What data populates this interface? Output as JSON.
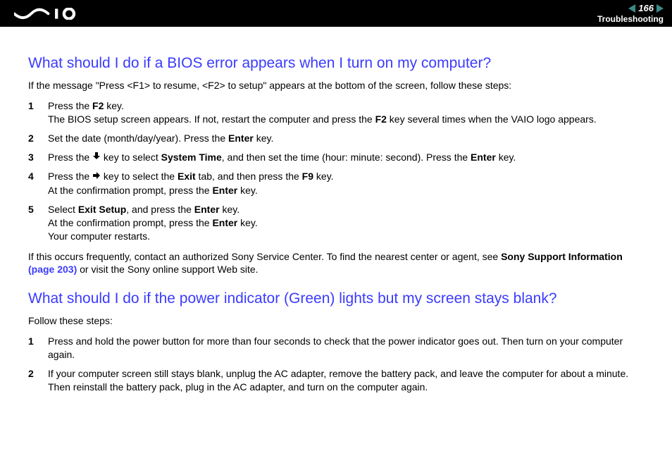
{
  "header": {
    "page_number": "166",
    "section": "Troubleshooting"
  },
  "section1": {
    "heading": "What should I do if a BIOS error appears when I turn on my computer?",
    "intro": "If the message \"Press <F1> to resume, <F2> to setup\" appears at the bottom of the screen, follow these steps:",
    "step1_a": "Press the ",
    "step1_b_bold": "F2",
    "step1_c": " key.",
    "step1_line2_a": "The BIOS setup screen appears. If not, restart the computer and press the ",
    "step1_line2_b_bold": "F2",
    "step1_line2_c": " key several times when the VAIO logo appears.",
    "step2_a": "Set the date (month/day/year). Press the ",
    "step2_b_bold": "Enter",
    "step2_c": " key.",
    "step3_a": "Press the ",
    "step3_b": " key to select ",
    "step3_c_bold": "System Time",
    "step3_d": ", and then set the time (hour: minute: second). Press the ",
    "step3_e_bold": "Enter",
    "step3_f": " key.",
    "step4_a": "Press the ",
    "step4_b": " key to select the ",
    "step4_c_bold": "Exit",
    "step4_d": " tab, and then press the ",
    "step4_e_bold": "F9",
    "step4_f": " key.",
    "step4_line2_a": "At the confirmation prompt, press the ",
    "step4_line2_b_bold": "Enter",
    "step4_line2_c": " key.",
    "step5_a": "Select ",
    "step5_b_bold": "Exit Setup",
    "step5_c": ", and press the ",
    "step5_d_bold": "Enter",
    "step5_e": " key.",
    "step5_line2_a": "At the confirmation prompt, press the ",
    "step5_line2_b_bold": "Enter",
    "step5_line2_c": " key.",
    "step5_line3": "Your computer restarts.",
    "outro_a": "If this occurs frequently, contact an authorized Sony Service Center. To find the nearest center or agent, see ",
    "outro_b_bold": "Sony Support Information ",
    "outro_c_link": "(page 203)",
    "outro_d": " or visit the Sony online support Web site."
  },
  "section2": {
    "heading": "What should I do if the power indicator (Green) lights but my screen stays blank?",
    "intro": "Follow these steps:",
    "step1": "Press and hold the power button for more than four seconds to check that the power indicator goes out. Then turn on your computer again.",
    "step2": "If your computer screen still stays blank, unplug the AC adapter, remove the battery pack, and leave the computer for about a minute. Then reinstall the battery pack, plug in the AC adapter, and turn on the computer again."
  }
}
